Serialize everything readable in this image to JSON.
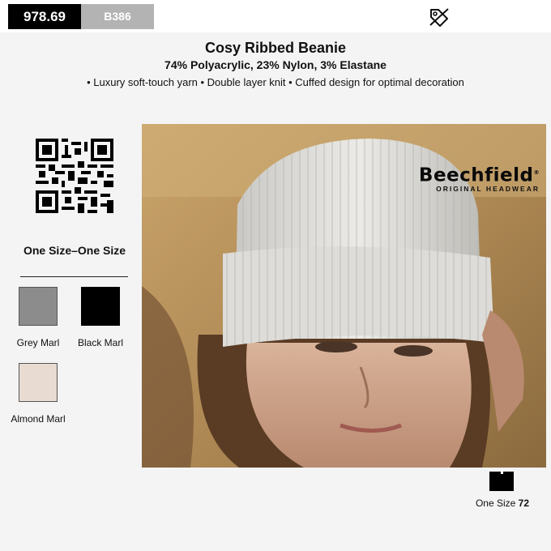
{
  "header": {
    "price": "978.69",
    "product_code": "B386",
    "tag_icon": "discount-tag-icon"
  },
  "product": {
    "title": "Cosy Ribbed Beanie",
    "material": "74% Polyacrylic, 23% Nylon, 3% Elastane",
    "features": "• Luxury soft-touch yarn • Double layer knit • Cuffed design for optimal decoration"
  },
  "sizes": {
    "title": "One Size–One Size"
  },
  "colours": [
    {
      "label": "Grey Marl",
      "hex": "#8c8c8c"
    },
    {
      "label": "Black Marl",
      "hex": "#000000"
    },
    {
      "label": "Almond Marl",
      "hex": "#e8dcd2"
    }
  ],
  "brand": {
    "name": "Beechfield",
    "registered": "®",
    "tagline": "ORIGINAL HEADWEAR"
  },
  "stock": {
    "size_label": "One Size",
    "quantity": "72",
    "icon": "box-icon"
  }
}
